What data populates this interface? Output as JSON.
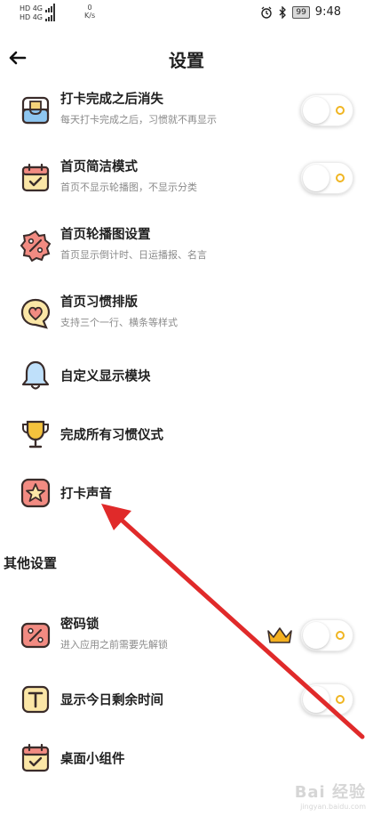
{
  "status_bar": {
    "net_1": "HD 4G",
    "net_2": "HD 4G",
    "speed_value": "0",
    "speed_unit": "K/s",
    "battery": "99",
    "time": "9:48"
  },
  "header": {
    "title": "设置"
  },
  "settings": [
    {
      "label": "打卡完成之后消失",
      "sub": "每天打卡完成之后，习惯就不再显示",
      "icon": "inbox-icon",
      "toggle": false
    },
    {
      "label": "首页简洁模式",
      "sub": "首页不显示轮播图，不显示分类",
      "icon": "calendar-check-icon",
      "toggle": false
    },
    {
      "label": "首页轮播图设置",
      "sub": "首页显示倒计时、日运播报、名言",
      "icon": "percent-badge-icon"
    },
    {
      "label": "首页习惯排版",
      "sub": "支持三个一行、横条等样式",
      "icon": "heart-bubble-icon"
    },
    {
      "label": "自定义显示模块",
      "icon": "bell-icon"
    },
    {
      "label": "完成所有习惯仪式",
      "icon": "trophy-icon"
    },
    {
      "label": "打卡声音",
      "icon": "star-icon"
    }
  ],
  "other_section": {
    "title": "其他设置"
  },
  "other_settings": [
    {
      "label": "密码锁",
      "sub": "进入应用之前需要先解锁",
      "icon": "lock-percent-icon",
      "toggle": false,
      "premium": true
    },
    {
      "label": "显示今日剩余时间",
      "icon": "letter-t-icon",
      "toggle": false
    },
    {
      "label": "桌面小组件",
      "icon": "calendar-widget-icon"
    }
  ],
  "watermark": {
    "text": "Bai 经验",
    "sub": "jingyan.baidu.com"
  },
  "colors": {
    "toggle_indicator": "#f0b522",
    "arrow": "#e02a2a",
    "icon_outline": "#3a2c2a"
  }
}
